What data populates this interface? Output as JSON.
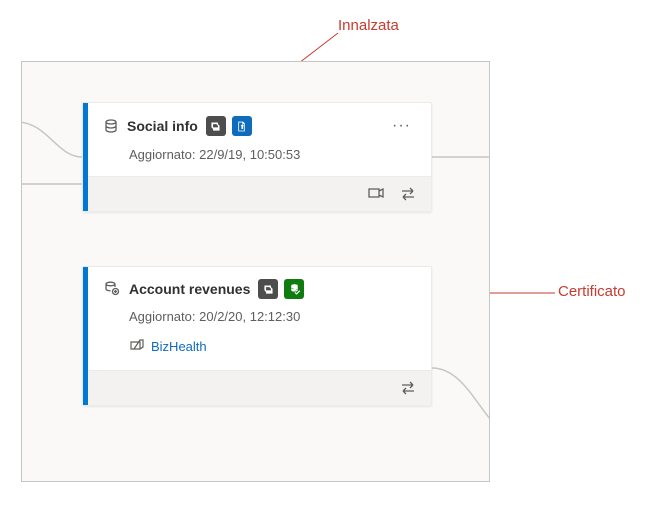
{
  "annotations": {
    "promoted": "Innalzata",
    "certified": "Certificato"
  },
  "cards": [
    {
      "title": "Social info",
      "updated_label": "Aggiornato:",
      "updated_value": "22/9/19, 10:50:53",
      "endorsement": "promoted",
      "has_more": true,
      "link": null
    },
    {
      "title": "Account revenues",
      "updated_label": "Aggiornato:",
      "updated_value": "20/2/20, 12:12:30",
      "endorsement": "certified",
      "has_more": false,
      "link": {
        "label": "BizHealth"
      }
    }
  ]
}
